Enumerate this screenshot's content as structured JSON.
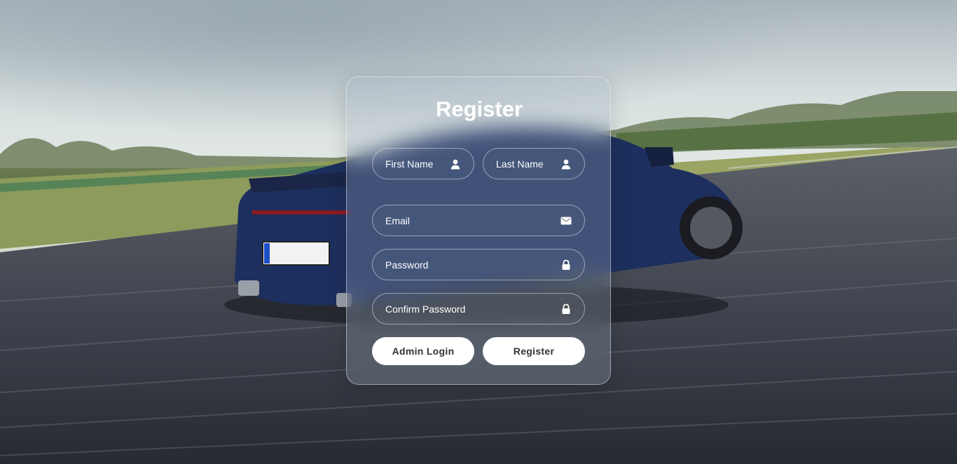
{
  "form": {
    "title": "Register",
    "first_name": {
      "placeholder": "First Name",
      "value": "",
      "icon": "user-icon"
    },
    "last_name": {
      "placeholder": "Last Name",
      "value": "",
      "icon": "user-icon"
    },
    "email": {
      "placeholder": "Email",
      "value": "",
      "icon": "envelope-icon"
    },
    "password": {
      "placeholder": "Password",
      "value": "",
      "icon": "lock-icon"
    },
    "confirm_password": {
      "placeholder": "Confirm Password",
      "value": "",
      "icon": "lock-icon"
    },
    "admin_login_label": "Admin Login",
    "register_label": "Register"
  },
  "colors": {
    "text": "#ffffff",
    "button_bg": "#ffffff",
    "button_text": "#333333",
    "car_blue": "#1d2f5e"
  }
}
